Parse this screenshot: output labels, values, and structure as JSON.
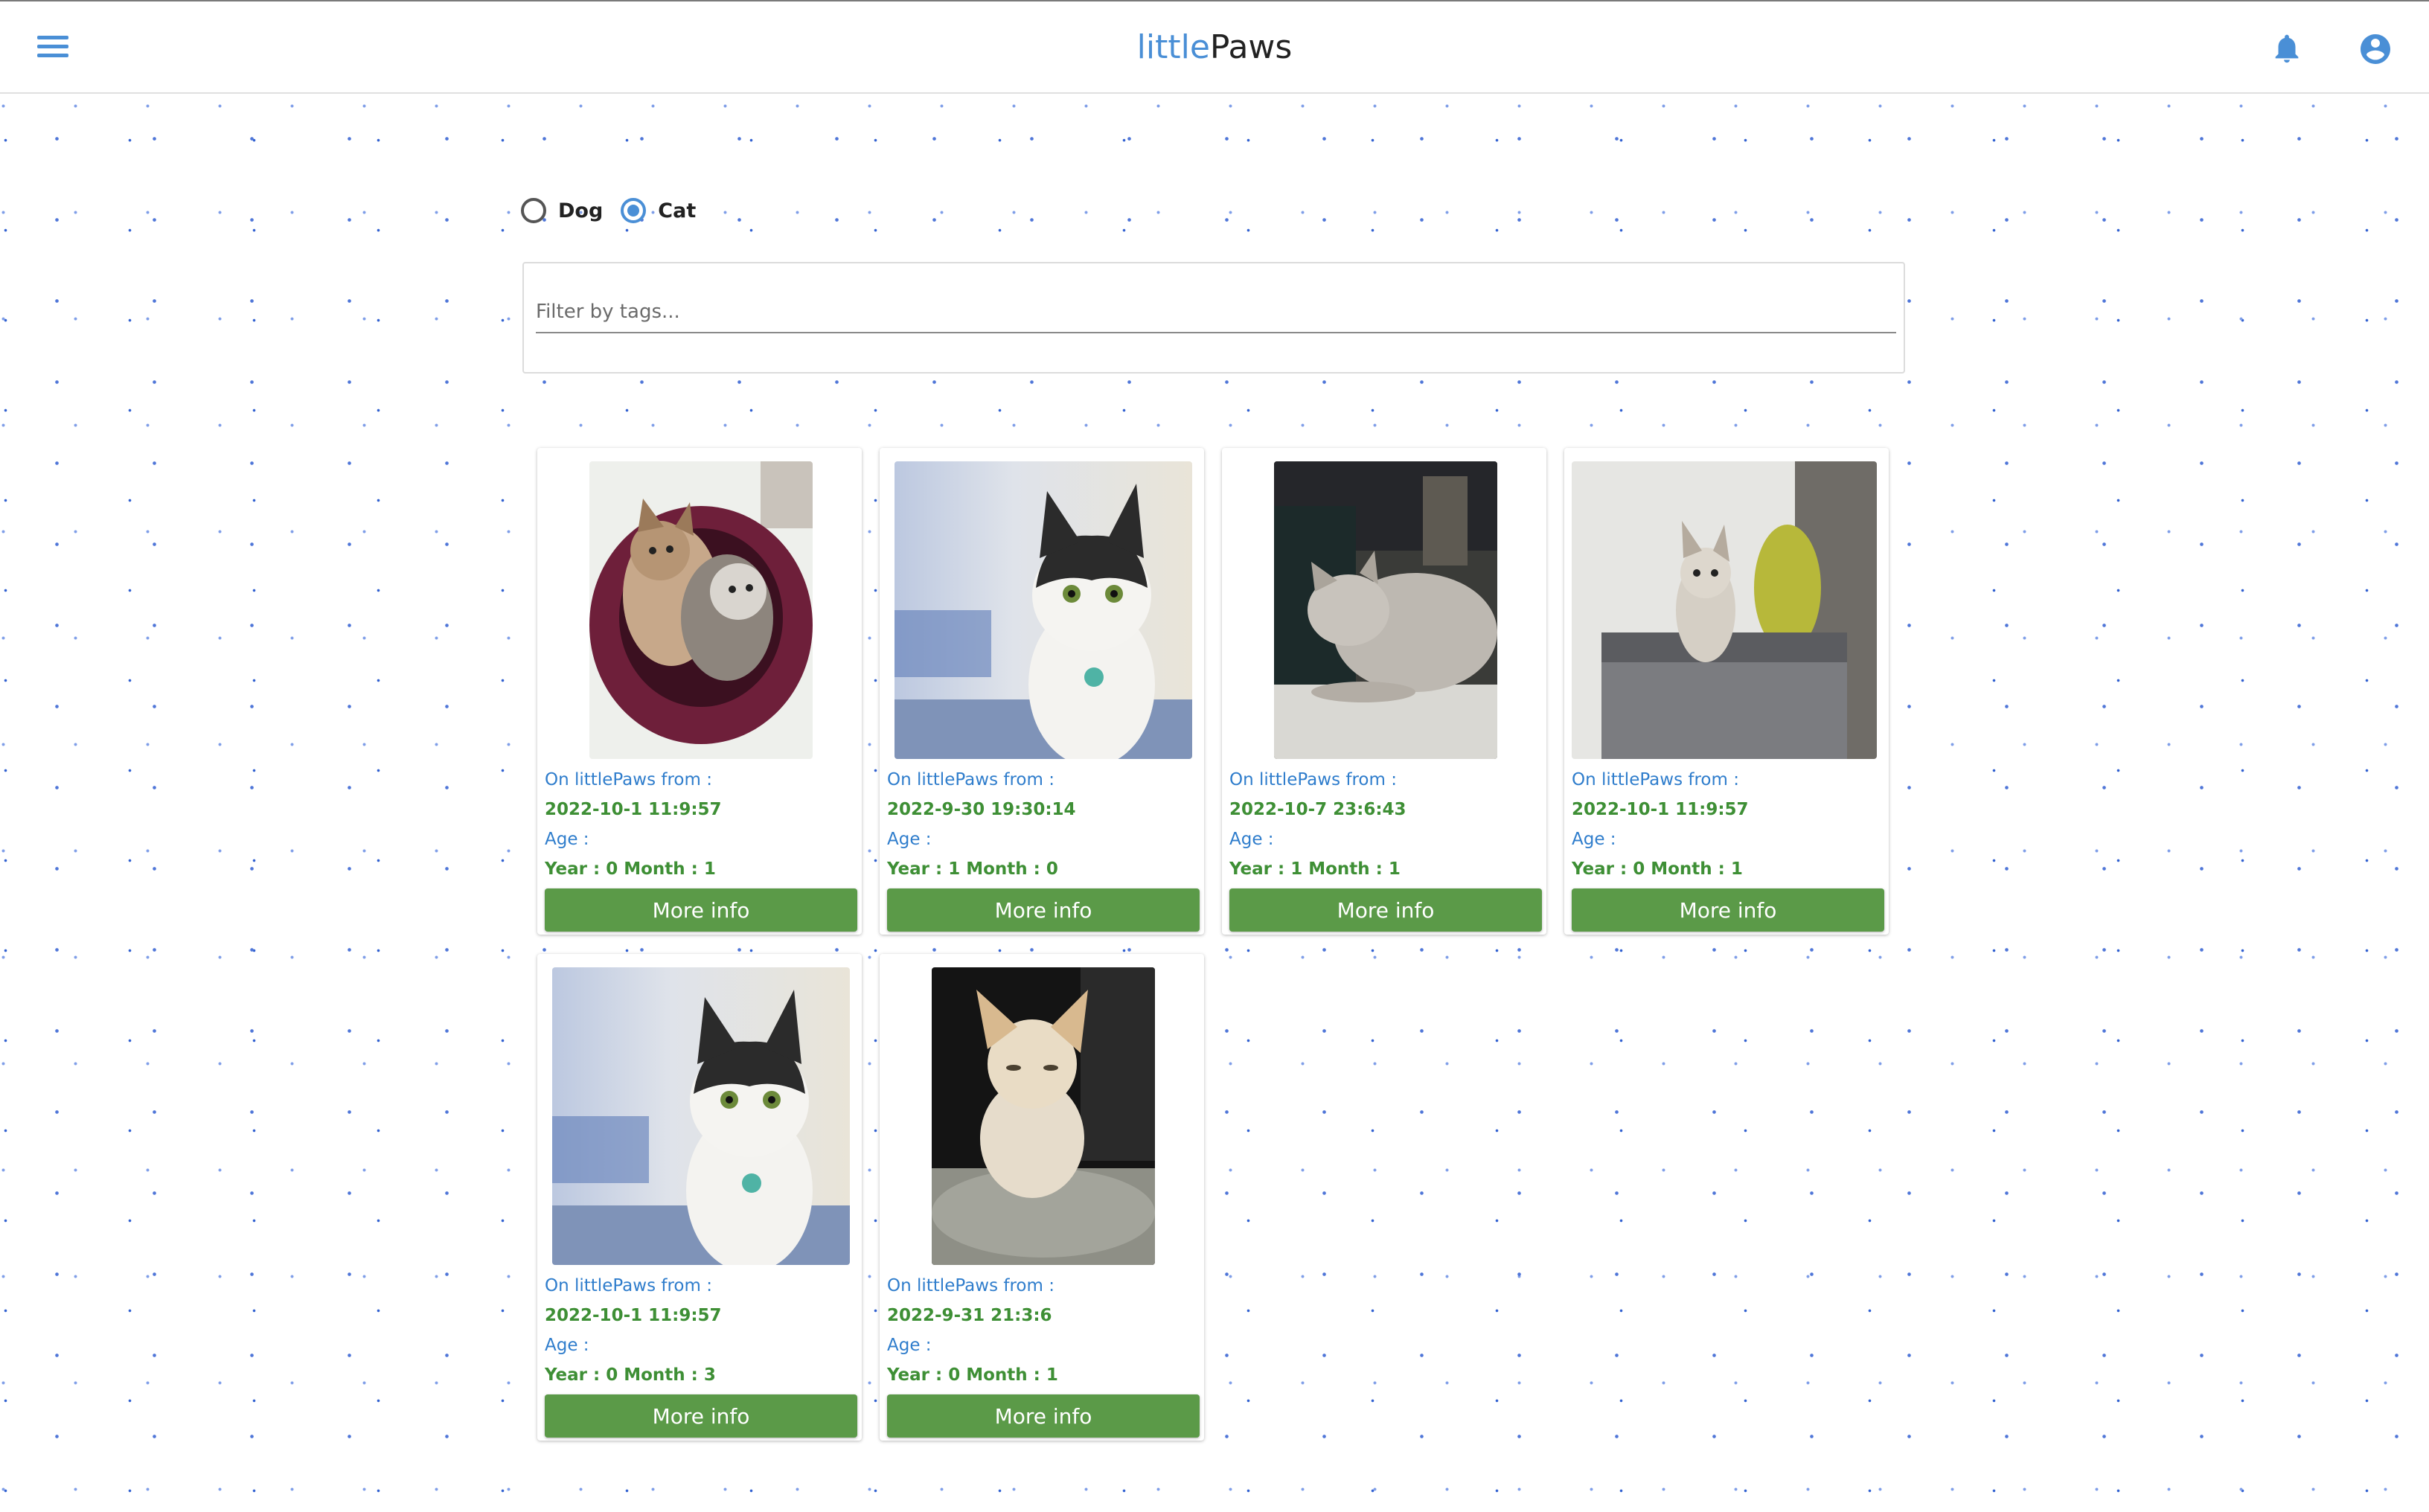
{
  "header": {
    "brand_light": "little",
    "brand_dark": "Paws",
    "menu_icon": "hamburger-menu-icon",
    "bell_icon": "bell-icon",
    "account_icon": "account-circle-icon",
    "accent_color": "#4a8fd6"
  },
  "species_filter": {
    "options": [
      {
        "label": "Dog",
        "selected": false
      },
      {
        "label": "Cat",
        "selected": true
      }
    ]
  },
  "tag_filter": {
    "placeholder": "Filter by tags...",
    "value": ""
  },
  "colors": {
    "label_blue": "#2f7dcc",
    "value_green": "#3e8f35",
    "button_green": "#5b9a48"
  },
  "pets": [
    {
      "on_label": "On littlePaws from :",
      "date": "2022-10-1 11:9:57",
      "age_label": "Age :",
      "age": "Year : 0 Month : 1",
      "button": "More info"
    },
    {
      "on_label": "On littlePaws from :",
      "date": "2022-9-30 19:30:14",
      "age_label": "Age :",
      "age": "Year : 1 Month : 0",
      "button": "More info"
    },
    {
      "on_label": "On littlePaws from :",
      "date": "2022-10-7 23:6:43",
      "age_label": "Age :",
      "age": "Year : 1 Month : 1",
      "button": "More info"
    },
    {
      "on_label": "On littlePaws from :",
      "date": "2022-10-1 11:9:57",
      "age_label": "Age :",
      "age": "Year : 0 Month : 1",
      "button": "More info"
    },
    {
      "on_label": "On littlePaws from :",
      "date": "2022-10-1 11:9:57",
      "age_label": "Age :",
      "age": "Year : 0 Month : 3",
      "button": "More info"
    },
    {
      "on_label": "On littlePaws from :",
      "date": "2022-9-31 21:3:6",
      "age_label": "Age :",
      "age": "Year : 0 Month : 1",
      "button": "More info"
    }
  ]
}
